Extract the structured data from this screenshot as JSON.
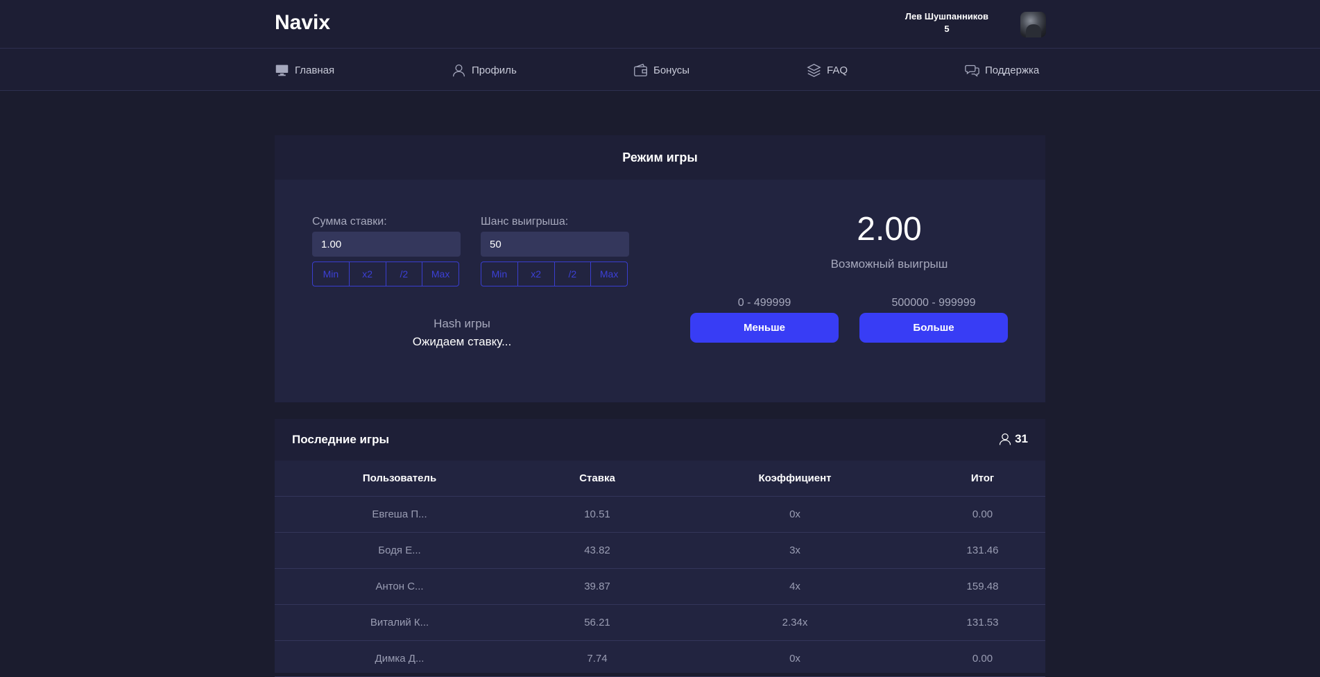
{
  "header": {
    "logo": "Navix",
    "user_name": "Лев Шушпанников",
    "user_balance": "5"
  },
  "nav": [
    {
      "label": "Главная",
      "icon": "monitor-icon"
    },
    {
      "label": "Профиль",
      "icon": "user-icon"
    },
    {
      "label": "Бонусы",
      "icon": "wallet-icon"
    },
    {
      "label": "FAQ",
      "icon": "layers-icon"
    },
    {
      "label": "Поддержка",
      "icon": "chat-icon"
    }
  ],
  "game": {
    "title": "Режим игры",
    "bet_label": "Сумма ставки:",
    "bet_value": "1.00",
    "chance_label": "Шанс выигрыша:",
    "chance_value": "50",
    "bet_buttons": [
      "Min",
      "x2",
      "/2",
      "Max"
    ],
    "chance_buttons": [
      "Min",
      "x2",
      "/2",
      "Max"
    ],
    "possible_win_value": "2.00",
    "possible_win_label": "Возможный выигрыш",
    "low_range": "0 - 499999",
    "high_range": "500000 - 999999",
    "low_button": "Меньше",
    "high_button": "Больше",
    "hash_label": "Hash игры",
    "hash_value": "Ожидаем ставку..."
  },
  "last_games": {
    "title": "Последние игры",
    "online_count": "31",
    "columns": [
      "Пользователь",
      "Ставка",
      "Коэффициент",
      "Итог"
    ],
    "rows": [
      [
        "Евгеша П...",
        "10.51",
        "0x",
        "0.00"
      ],
      [
        "Бодя Е...",
        "43.82",
        "3x",
        "131.46"
      ],
      [
        "Антон С...",
        "39.87",
        "4x",
        "159.48"
      ],
      [
        "Виталий К...",
        "56.21",
        "2.34x",
        "131.53"
      ],
      [
        "Димка Д...",
        "7.74",
        "0x",
        "0.00"
      ]
    ]
  },
  "colors": {
    "background": "#1b1c2e",
    "card": "#222440",
    "accent": "#383df5"
  }
}
